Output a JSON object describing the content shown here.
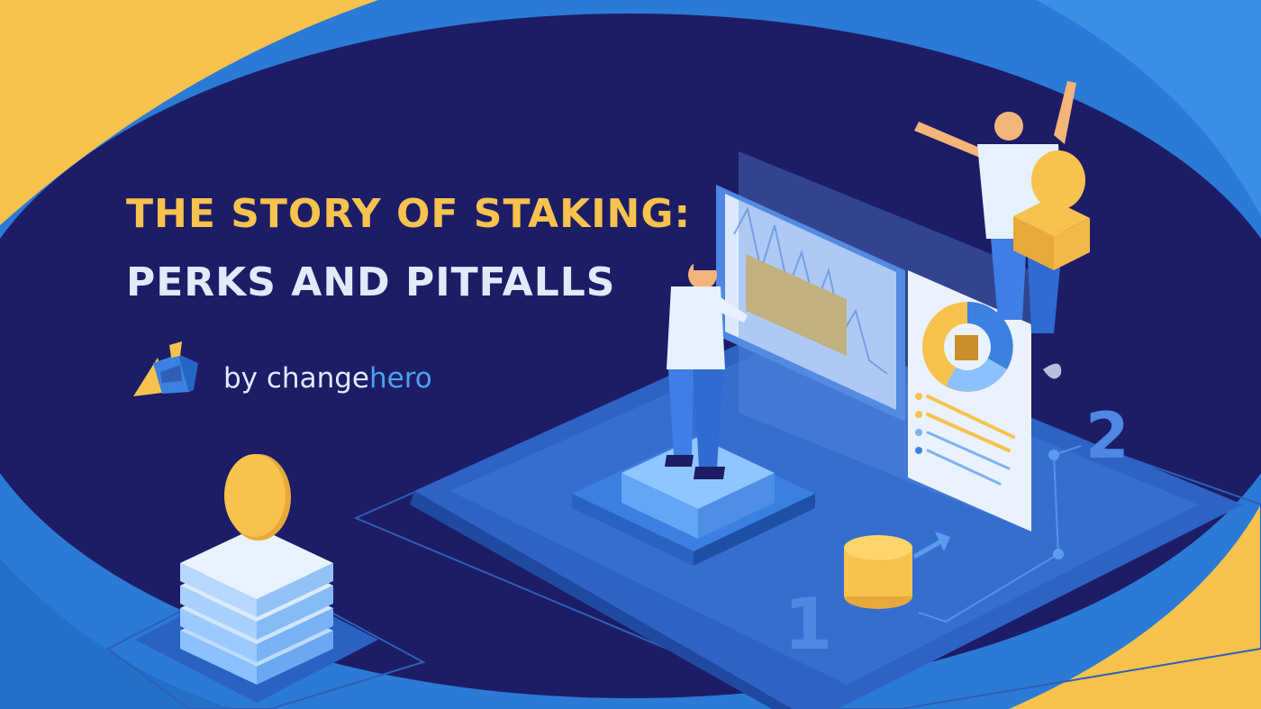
{
  "headline": {
    "line1": "THE STORY OF STAKING:",
    "line2": "PERKS AND PITFALLS"
  },
  "brand": {
    "prefix": "by ",
    "name_plain": "change",
    "name_accent": "hero",
    "logo_icon": "changehero-logo-icon"
  },
  "illustration": {
    "step_numbers": [
      "1",
      "2"
    ],
    "icons": [
      "coin-stack-icon",
      "chart-panel-icon",
      "donut-chart-icon",
      "person-icon",
      "coin-box-icon",
      "arrow-icon"
    ]
  },
  "colors": {
    "background": "#1c1d66",
    "outer_blue": "#2b7ad6",
    "outer_yellow": "#f7c24d",
    "title_yellow": "#f7c24d",
    "title_light": "#dfeafb",
    "accent_blue": "#4f9fec"
  }
}
